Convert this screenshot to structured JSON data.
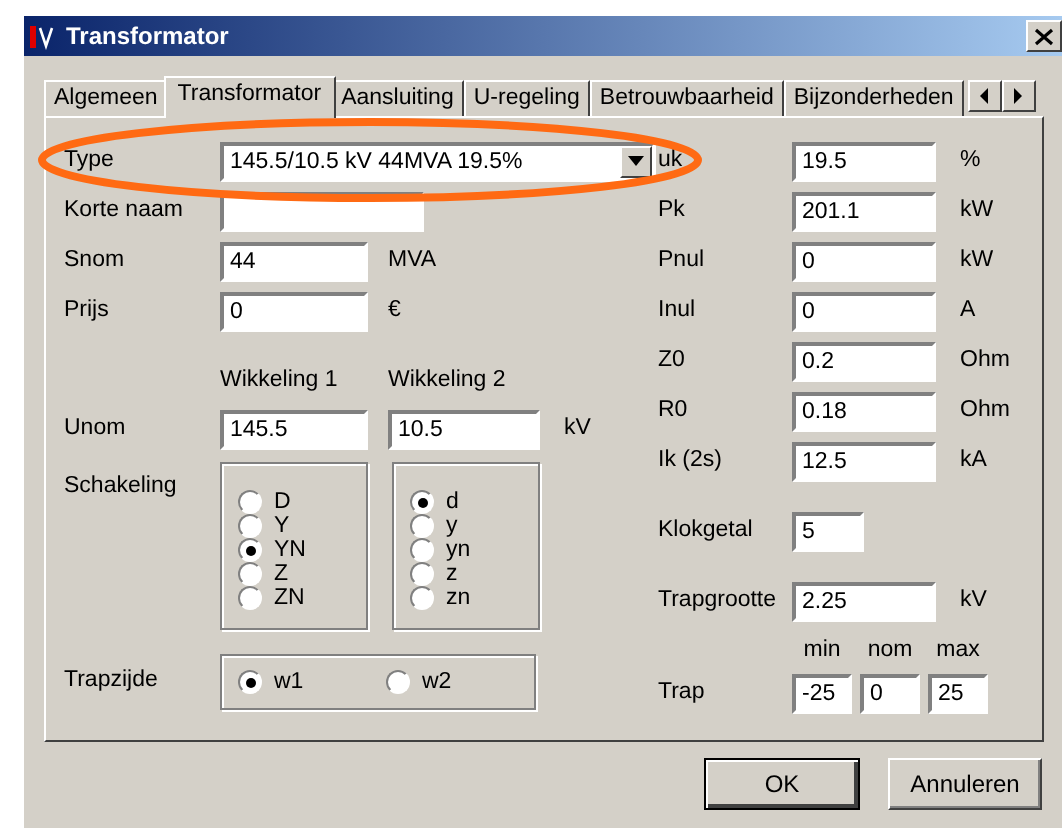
{
  "window": {
    "title": "Transformator"
  },
  "tabs": [
    {
      "label": "Algemeen",
      "selected": false
    },
    {
      "label": "Transformator",
      "selected": true
    },
    {
      "label": "Aansluiting",
      "selected": false
    },
    {
      "label": "U-regeling",
      "selected": false
    },
    {
      "label": "Betrouwbaarheid",
      "selected": false
    },
    {
      "label": "Bijzonderheden",
      "selected": false
    }
  ],
  "type": {
    "label": "Type",
    "value": "145.5/10.5 kV 44MVA 19.5%"
  },
  "left_fields": [
    {
      "label": "Korte naam"
    },
    {
      "label": "Snom",
      "value": "44",
      "unit": "MVA"
    },
    {
      "label": "Prijs",
      "value": "0",
      "unit": "€"
    }
  ],
  "windings": {
    "headers": [
      "Wikkeling 1",
      "Wikkeling 2"
    ],
    "unom": {
      "label": "Unom",
      "values": [
        "145.5",
        "10.5"
      ],
      "unit": "kV"
    },
    "schakeling": {
      "label": "Schakeling",
      "groups": [
        [
          {
            "label": "D",
            "selected": false
          },
          {
            "label": "Y",
            "selected": false
          },
          {
            "label": "YN",
            "selected": true
          },
          {
            "label": "Z",
            "selected": false
          },
          {
            "label": "ZN",
            "selected": false
          }
        ],
        [
          {
            "label": "d",
            "selected": true
          },
          {
            "label": "y",
            "selected": false
          },
          {
            "label": "yn",
            "selected": false
          },
          {
            "label": "z",
            "selected": false
          },
          {
            "label": "zn",
            "selected": false
          }
        ]
      ]
    }
  },
  "trapzijde": {
    "label": "Trapzijde",
    "options": [
      {
        "label": "w1",
        "selected": true
      },
      {
        "label": "w2",
        "selected": false
      }
    ]
  },
  "right_fields": [
    {
      "label": "uk",
      "value": "19.5",
      "unit": "%"
    },
    {
      "label": "Pk",
      "value": "201.1",
      "unit": "kW"
    },
    {
      "label": "Pnul",
      "value": "0",
      "unit": "kW"
    },
    {
      "label": "Inul",
      "value": "0",
      "unit": "A"
    },
    {
      "label": "Z0",
      "value": "0.2",
      "unit": "Ohm"
    },
    {
      "label": "R0",
      "value": "0.18",
      "unit": "Ohm"
    },
    {
      "label": "Ik (2s)",
      "value": "12.5",
      "unit": "kA"
    }
  ],
  "klokgetal": {
    "label": "Klokgetal",
    "value": "5"
  },
  "trapgrootte": {
    "label": "Trapgrootte",
    "value": "2.25",
    "unit": "kV"
  },
  "trap": {
    "label": "Trap",
    "headers": [
      "min",
      "nom",
      "max"
    ],
    "values": [
      "-25",
      "0",
      "25"
    ]
  },
  "buttons": [
    {
      "label": "OK",
      "default": true
    },
    {
      "label": "Annuleren",
      "default": false
    }
  ]
}
